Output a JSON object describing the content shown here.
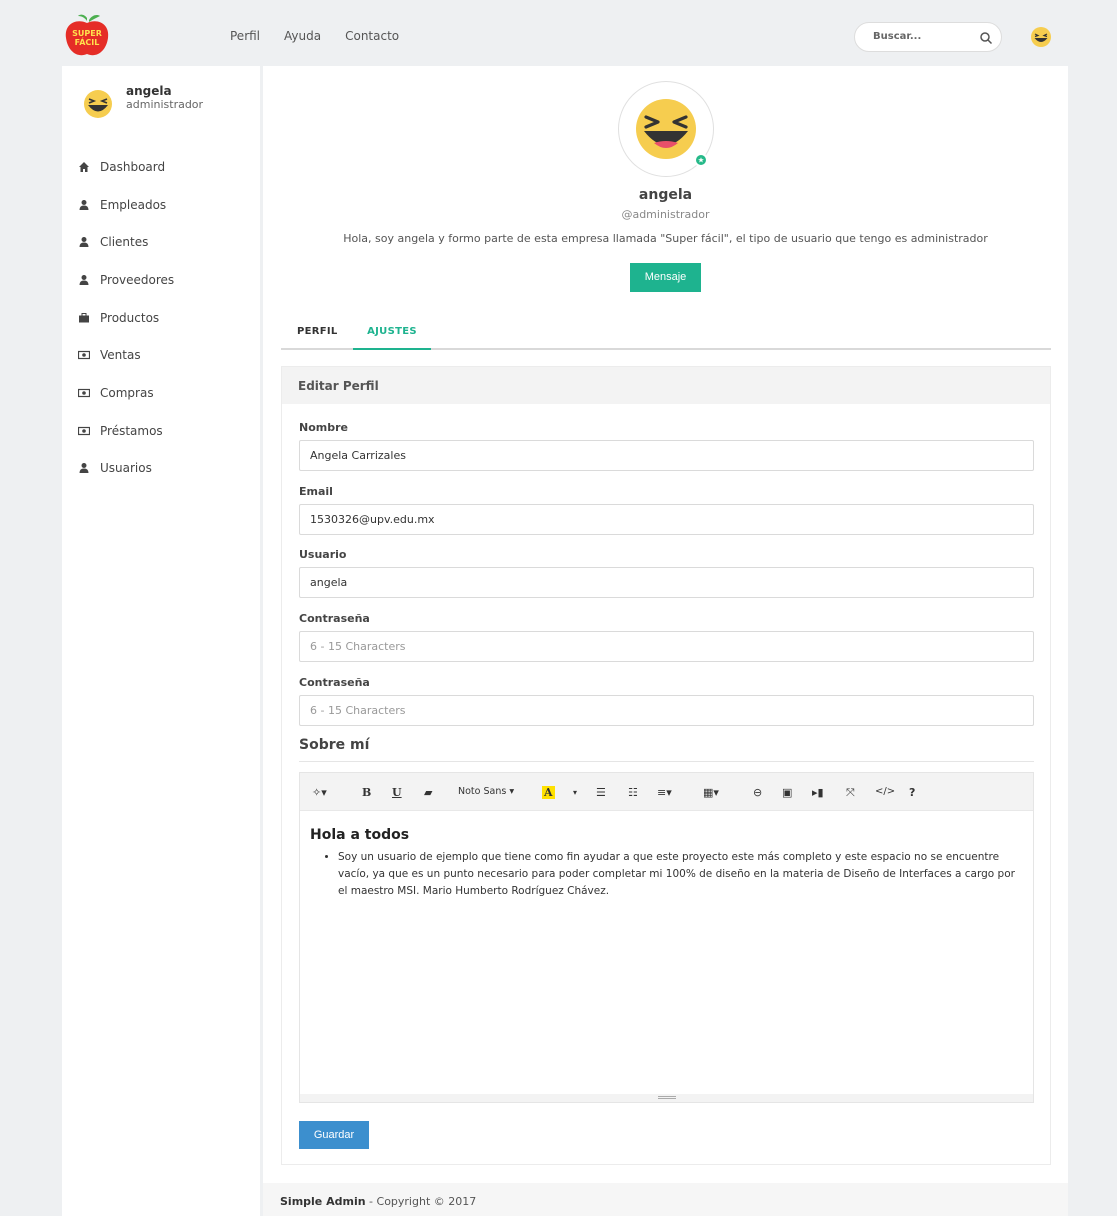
{
  "brand": {
    "logo_text_line1": "SUPER",
    "logo_text_line2": "FÁCIL"
  },
  "topnav": {
    "items": [
      "Perfil",
      "Ayuda",
      "Contacto"
    ]
  },
  "search": {
    "placeholder": "Buscar..."
  },
  "sidebar": {
    "user_name": "angela",
    "user_role": "administrador",
    "items": [
      {
        "label": "Dashboard",
        "icon": "home-icon"
      },
      {
        "label": "Empleados",
        "icon": "user-icon"
      },
      {
        "label": "Clientes",
        "icon": "user-icon"
      },
      {
        "label": "Proveedores",
        "icon": "user-icon"
      },
      {
        "label": "Productos",
        "icon": "briefcase-icon"
      },
      {
        "label": "Ventas",
        "icon": "money-icon"
      },
      {
        "label": "Compras",
        "icon": "money-icon"
      },
      {
        "label": "Préstamos",
        "icon": "money-icon"
      },
      {
        "label": "Usuarios",
        "icon": "user-icon"
      }
    ]
  },
  "profile": {
    "name": "angela",
    "handle": "@administrador",
    "bio": "Hola, soy angela y formo parte de esta empresa llamada \"Super fácil\", el tipo de usuario que tengo es administrador",
    "message_button": "Mensaje"
  },
  "tabs": {
    "perfil": "PERFIL",
    "ajustes": "AJUSTES"
  },
  "form": {
    "title": "Editar Perfil",
    "nombre_label": "Nombre",
    "nombre_value": "Angela Carrizales",
    "email_label": "Email",
    "email_value": "1530326@upv.edu.mx",
    "usuario_label": "Usuario",
    "usuario_value": "angela",
    "pass1_label": "Contraseña",
    "pass1_placeholder": "6 - 15 Characters",
    "pass2_label": "Contraseña",
    "pass2_placeholder": "6 - 15 Characters",
    "sobre_title": "Sobre mí",
    "save_button": "Guardar"
  },
  "editor": {
    "font_name": "Noto Sans",
    "heading": "Hola a todos",
    "bullet": "Soy un usuario de ejemplo que tiene como fin ayudar a que este proyecto este más completo y este espacio no se encuentre vacío, ya que es un punto necesario para poder completar mi 100% de diseño en la materia de Diseño de Interfaces a cargo por el maestro MSI. Mario Humberto Rodríguez Chávez."
  },
  "footer": {
    "brand": "Simple Admin",
    "copyright": " - Copyright © 2017"
  },
  "colors": {
    "accent": "#1eb38f",
    "primary": "#3c8fce",
    "logo_red": "#e52d27",
    "logo_leaf": "#4caf50",
    "emoji": "#f6cd4f"
  }
}
